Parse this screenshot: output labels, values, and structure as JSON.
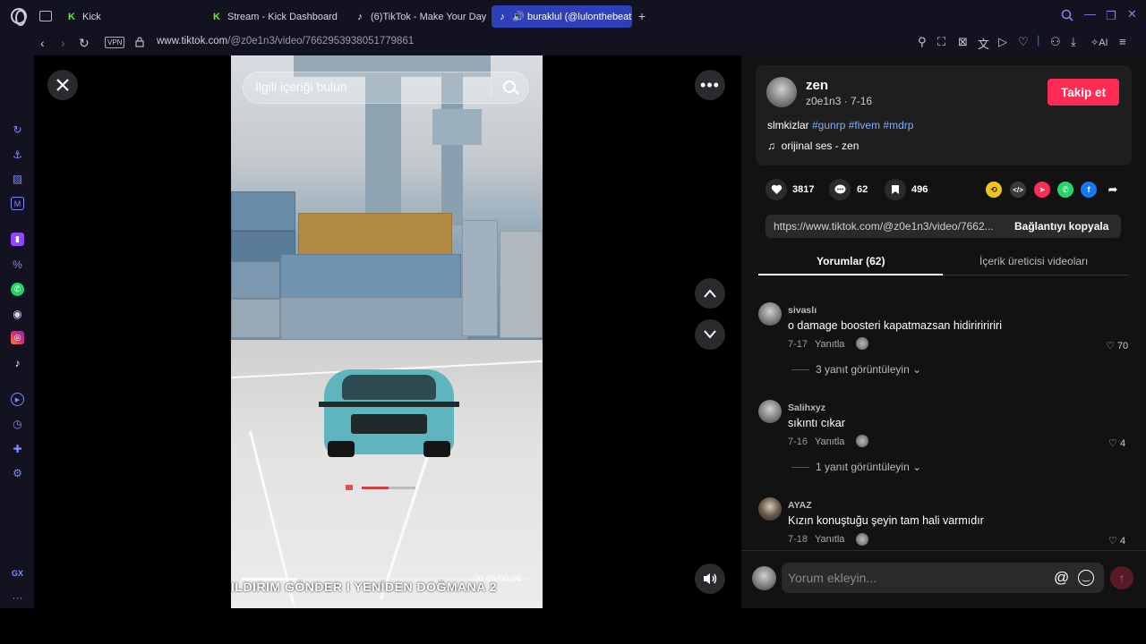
{
  "browser": {
    "tabs": [
      {
        "label": "Kick",
        "icon": "kick-logo"
      },
      {
        "label": "Stream - Kick Dashboard",
        "icon": "kick-logo"
      },
      {
        "label": "(6)TikTok - Make Your Day",
        "icon": "tiktok-logo"
      },
      {
        "label": "buraklul (@lulonthebeat",
        "icon": "tiktok-logo",
        "audio": true
      }
    ],
    "vpn_label": "VPN",
    "url_host": "www.tiktok.com",
    "url_path": "/@z0e1n3/video/7662953938051779861",
    "ai_label": "AI",
    "accent": "#2f3fb8"
  },
  "video": {
    "search_placeholder": "İlgili içeriği bulun",
    "time": "00:05/00:26",
    "subtitle": "ILDIRIM GÖNDER I YENİDEN DOĞMANA 2",
    "progress_fraction": 0.19
  },
  "author": {
    "name": "zen",
    "handle_date": "z0e1n3 · 7-16",
    "follow_label": "Takip et",
    "follow_color": "#fe2c55",
    "caption_text": "slmkizlar ",
    "hashtags": [
      "#gunrp",
      "#fivem",
      "#mdrp"
    ],
    "music": "orijinal ses - zen"
  },
  "stats": {
    "likes": "3817",
    "comments": "62",
    "saves": "496"
  },
  "link": {
    "url": "https://www.tiktok.com/@z0e1n3/video/7662...",
    "copy_label": "Bağlantıyı kopyala"
  },
  "panel_tabs": {
    "comments": "Yorumlar (62)",
    "creator_videos": "İçerik üreticisi videoları"
  },
  "comments": [
    {
      "user": "sivaslı",
      "text": "o damage boosteri kapatmazsan hidiririririri",
      "date": "7-17",
      "reply": "Yanıtla",
      "likes": "70",
      "view_replies": "3 yanıt görüntüleyin"
    },
    {
      "user": "Salihxyz",
      "text": "sıkıntı cıkar",
      "date": "7-16",
      "reply": "Yanıtla",
      "likes": "4",
      "view_replies": "1 yanıt görüntüleyin"
    },
    {
      "user": "AYAZ",
      "text": "Kızın konuştuğu şeyin tam hali varmıdır",
      "date": "7-18",
      "reply": "Yanıtla",
      "likes": "4"
    }
  ],
  "comment_input": {
    "placeholder": "Yorum ekleyin...",
    "mention": "@"
  }
}
